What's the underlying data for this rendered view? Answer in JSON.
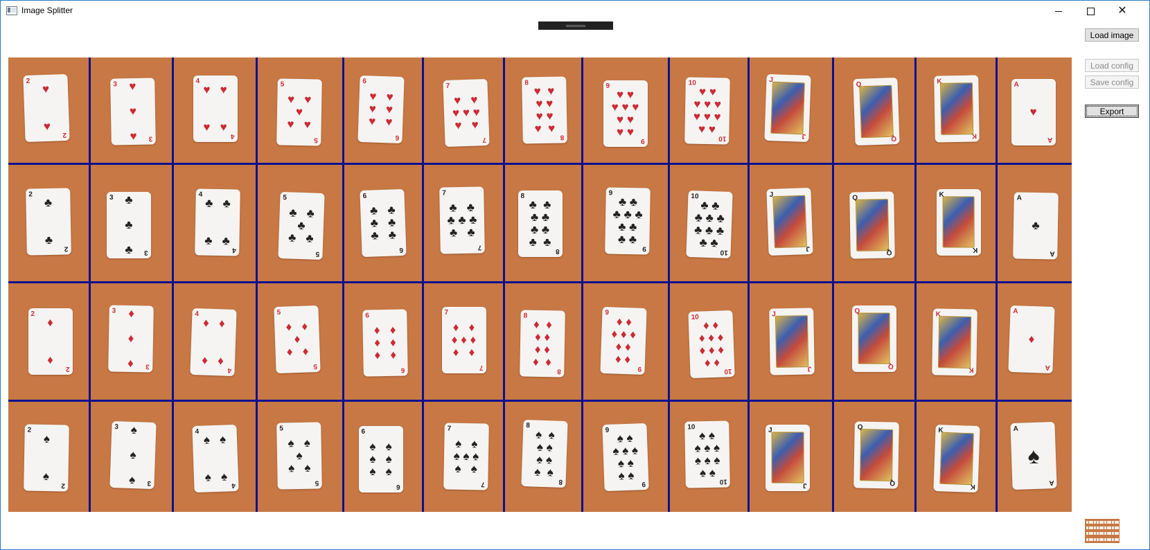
{
  "window": {
    "title": "Image Splitter",
    "icon": "app-window-icon",
    "controls": {
      "minimize": "minimize-icon",
      "maximize": "maximize-icon",
      "close": "close-icon"
    }
  },
  "buttons": {
    "load_image": "Load image",
    "load_config": "Load config",
    "save_config": "Save config",
    "export": "Export"
  },
  "grid": {
    "columns": 13,
    "rows": 4,
    "line_color": "#0b1190",
    "background_color": "#c87844"
  },
  "cards": {
    "ranks": [
      "2",
      "3",
      "4",
      "5",
      "6",
      "7",
      "8",
      "9",
      "10",
      "J",
      "Q",
      "K",
      "A"
    ],
    "suits": [
      {
        "name": "hearts",
        "symbol": "♥",
        "color": "#cc2b35"
      },
      {
        "name": "clubs",
        "symbol": "♣",
        "color": "#222222"
      },
      {
        "name": "diamonds",
        "symbol": "♦",
        "color": "#cc2b35"
      },
      {
        "name": "spades",
        "symbol": "♠",
        "color": "#222222"
      }
    ]
  }
}
